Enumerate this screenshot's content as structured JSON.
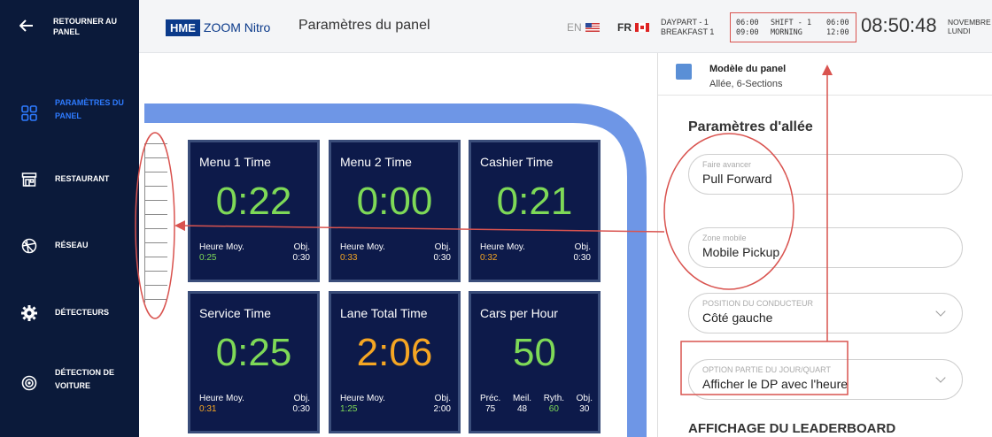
{
  "sidebar": {
    "back_label": "RETOURNER AU PANEL",
    "items": [
      {
        "label": "PARAMÈTRES DU PANEL",
        "icon": "grid-icon",
        "active": true
      },
      {
        "label": "RESTAURANT",
        "icon": "store-icon"
      },
      {
        "label": "RÉSEAU",
        "icon": "network-icon"
      },
      {
        "label": "DÉTECTEURS",
        "icon": "gear-icon"
      },
      {
        "label": "DÉTECTION DE VOITURE",
        "icon": "car-detection-icon"
      }
    ]
  },
  "header": {
    "brand_hme": "HME",
    "brand_zoom": "ZOOM Nitro",
    "title": "Paramètres du panel",
    "lang_en": "EN",
    "lang_fr": "FR",
    "daypart_line1": "DAYPART - 1",
    "daypart_line2": "BREAKFAST 1",
    "shift_start_1": "06:00",
    "shift_start_2": "09:00",
    "shift_name_1": "SHIFT - 1",
    "shift_name_2": "MORNING",
    "shift_end_1": "06:00",
    "shift_end_2": "12:00",
    "clock": "08:50:48",
    "date_line1": "NOVEMBRE",
    "date_line2": "LUNDI"
  },
  "tiles": [
    {
      "title": "Menu 1 Time",
      "value": "0:22",
      "color": "green",
      "avg_label": "Heure Moy.",
      "avg": "0:25",
      "avg_color": "green",
      "goal_label": "Obj.",
      "goal": "0:30"
    },
    {
      "title": "Menu 2 Time",
      "value": "0:00",
      "color": "green",
      "avg_label": "Heure Moy.",
      "avg": "0:33",
      "avg_color": "orange",
      "goal_label": "Obj.",
      "goal": "0:30"
    },
    {
      "title": "Cashier Time",
      "value": "0:21",
      "color": "green",
      "avg_label": "Heure Moy.",
      "avg": "0:32",
      "avg_color": "orange",
      "goal_label": "Obj.",
      "goal": "0:30"
    },
    {
      "title": "Service Time",
      "value": "0:25",
      "color": "green",
      "avg_label": "Heure Moy.",
      "avg": "0:31",
      "avg_color": "orange",
      "goal_label": "Obj.",
      "goal": "0:30"
    },
    {
      "title": "Lane Total Time",
      "value": "2:06",
      "color": "orange",
      "avg_label": "Heure Moy.",
      "avg": "1:25",
      "avg_color": "green",
      "goal_label": "Obj.",
      "goal": "2:00"
    }
  ],
  "cars_tile": {
    "title": "Cars per Hour",
    "value": "50",
    "stats": [
      {
        "label": "Préc.",
        "value": "75"
      },
      {
        "label": "Meil.",
        "value": "48"
      },
      {
        "label": "Ryth.",
        "value": "60",
        "highlight": true
      },
      {
        "label": "Obj.",
        "value": "30"
      }
    ]
  },
  "panel": {
    "model_title": "Modèle du panel",
    "model_sub": "Allée, 6-Sections",
    "section_title": "Paramètres d'allée",
    "fields": [
      {
        "label": "Faire avancer",
        "value": "Pull Forward"
      },
      {
        "label": "Zone mobile",
        "value": "Mobile Pickup"
      },
      {
        "label": "POSITION DU CONDUCTEUR",
        "value": "Côté gauche"
      },
      {
        "label": "OPTION PARTIE DU JOUR/QUART",
        "value": "Afficher le DP avec l'heure"
      }
    ],
    "leaderboard_title": "AFFICHAGE DU LEADERBOARD"
  },
  "colors": {
    "sidebar_bg": "#0b1a3a",
    "accent": "#2e7bff",
    "tile_bg": "#0d1a4a",
    "green": "#7ed957",
    "orange": "#f5a623",
    "lane_blue": "#6e96e6",
    "annotation_red": "#d9534f"
  }
}
